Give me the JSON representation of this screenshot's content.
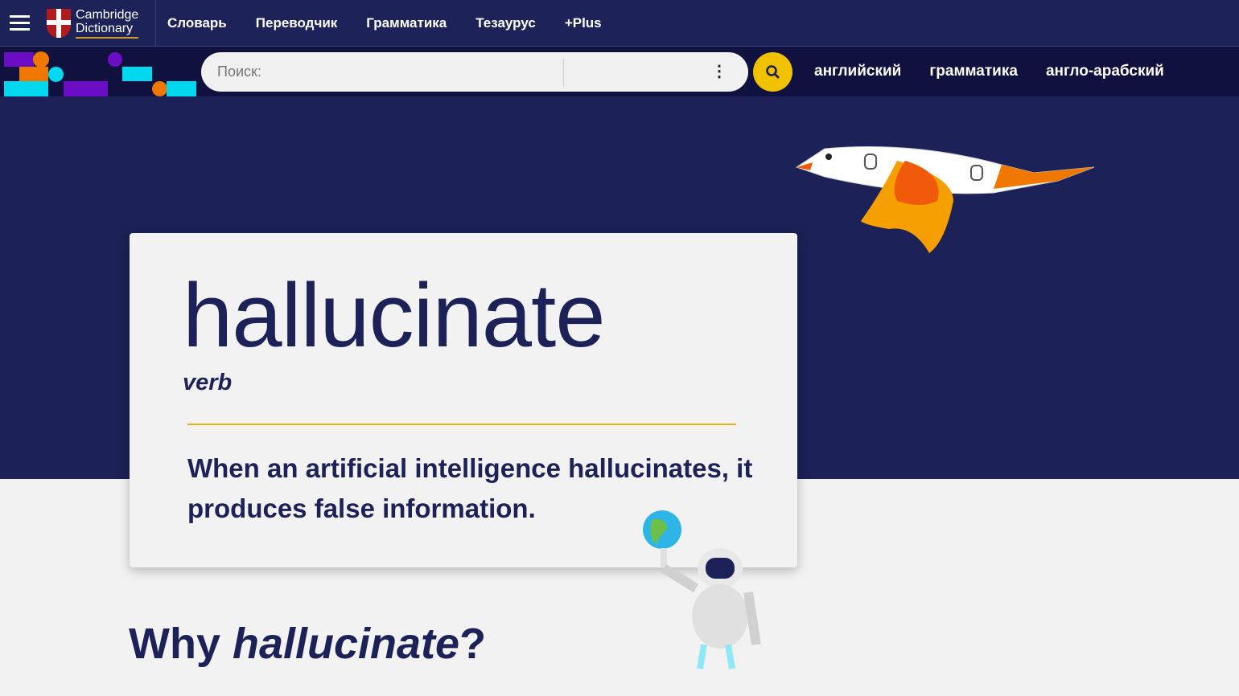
{
  "header": {
    "logo": "Cambridge Dictionary",
    "nav": [
      "Словарь",
      "Переводчик",
      "Грамматика",
      "Тезаурус",
      "+Plus"
    ]
  },
  "search": {
    "placeholder": "Поиск:",
    "quick_links": [
      "английский",
      "грамматика",
      "англо-арабский"
    ]
  },
  "entry": {
    "headword": "hallucinate",
    "pos": "verb",
    "definition": "When an artificial intelligence hallucinates, it produces false information."
  },
  "why": {
    "prefix": "Why ",
    "word": "hallucinate",
    "suffix": "?"
  },
  "colors": {
    "header": "#1d2359",
    "hero": "#1c2157",
    "accent": "#f1c200",
    "purple": "#6a0dc4",
    "orange": "#f07800",
    "cyan": "#00d8f0"
  }
}
